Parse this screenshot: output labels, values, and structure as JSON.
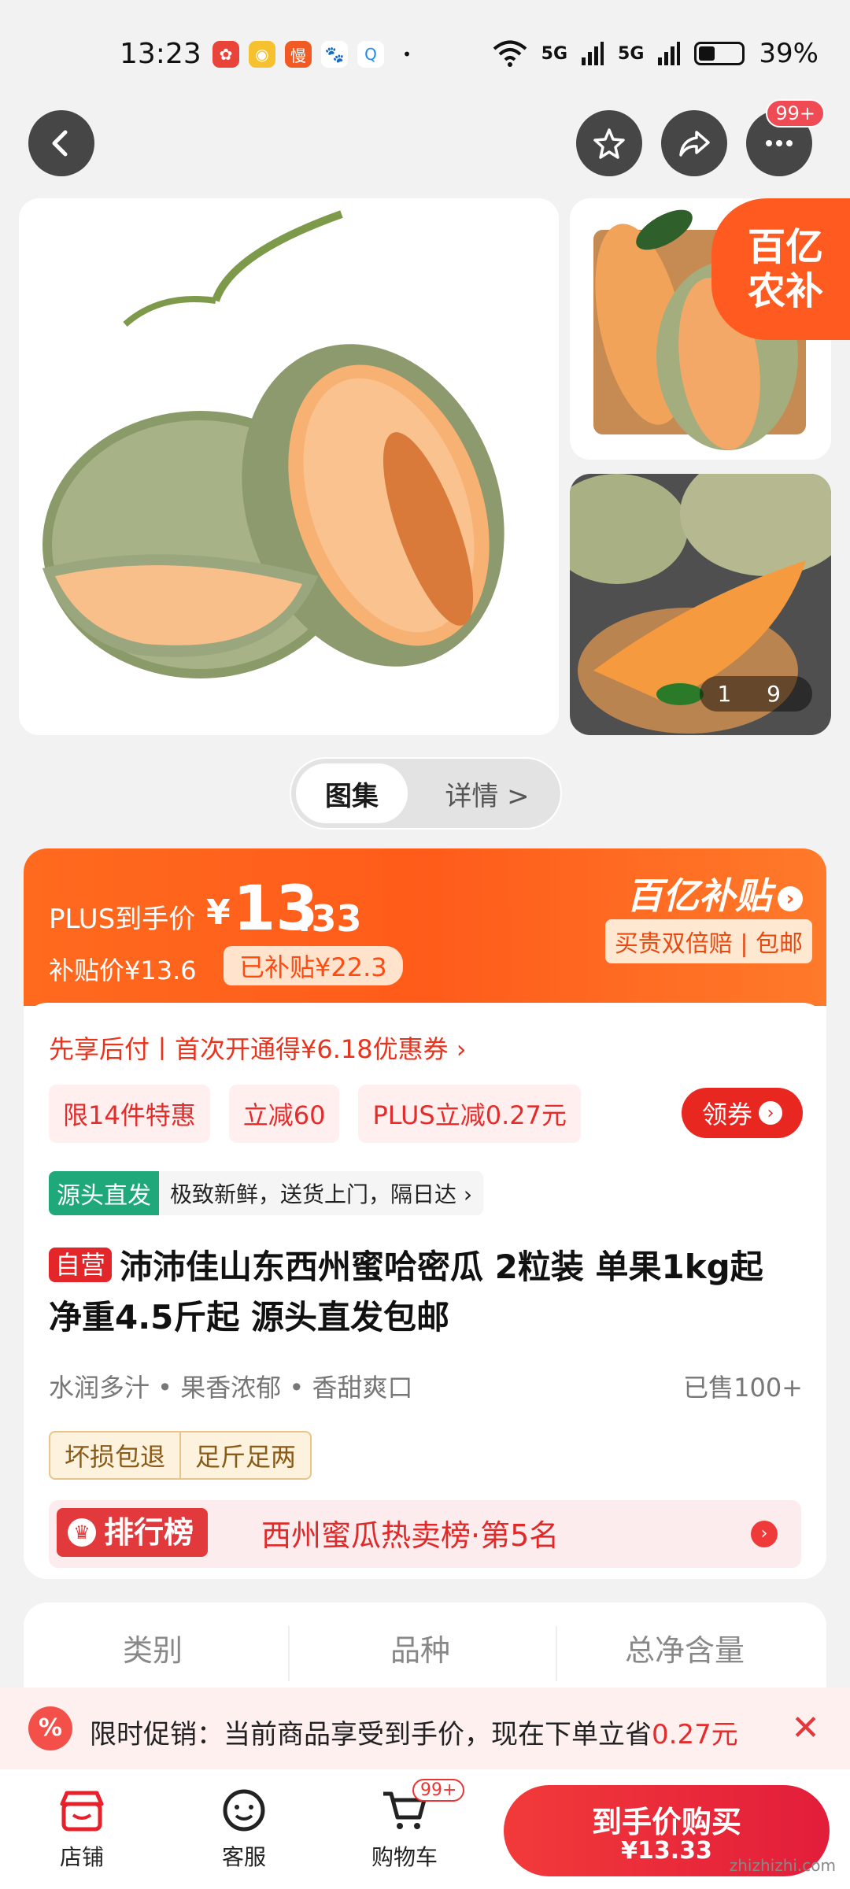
{
  "status_bar": {
    "time": "13:23",
    "battery": "39%",
    "signal_1": "5G",
    "signal_2": "5G"
  },
  "header": {
    "more_badge": "99+"
  },
  "gallery": {
    "corner_badge": "百亿\n农补",
    "counter": "1 9"
  },
  "view_toggle": {
    "active": "图集",
    "inactive": "详情 >"
  },
  "price_card": {
    "plus_label": "PLUS到手价",
    "plus_currency": "¥",
    "plus_integer": "13",
    "plus_decimal": ".33",
    "subsidy_price": "补贴价¥13.6",
    "subsidy_tag": "已补贴¥22.3",
    "brand_title": "百亿补贴",
    "brand_subtitle": "买贵双倍赔 | 包邮",
    "pay_later": "先享后付丨首次开通得¥6.18优惠券 ›",
    "promos": [
      "限14件特惠",
      "立减60",
      "PLUS立减0.27元"
    ],
    "coupon_label": "领券",
    "source_tag": "源头直发",
    "source_text": "极致新鲜，送货上门，隔日达 ›",
    "self_operated": "自营",
    "product_title": "沛沛佳山东西州蜜哈密瓜 2粒装 单果1kg起 净重4.5斤起 源头直发包邮",
    "features": "水润多汁 • 果香浓郁 • 香甜爽口",
    "sold": "已售100+",
    "guarantees": [
      "坏损包退",
      "足斤足两"
    ],
    "rank_tag": "排行榜",
    "rank_text": "西州蜜瓜热卖榜·第5名"
  },
  "spec": {
    "columns": [
      "类别",
      "品种",
      "总净含量"
    ]
  },
  "promo_strip": {
    "text": "限时促销：当前商品享受到手价，现在下单立省",
    "amount": "0.27元"
  },
  "bottom_nav": {
    "shop": "店铺",
    "service": "客服",
    "cart": "购物车",
    "cart_badge": "99+",
    "buy_label": "到手价购买",
    "buy_price": "¥13.33"
  },
  "watermark": "zhizhizhi.com",
  "colors": {
    "accent_orange": "#ff5a1f",
    "accent_red": "#e23a3c",
    "source_green": "#1fa97b"
  }
}
